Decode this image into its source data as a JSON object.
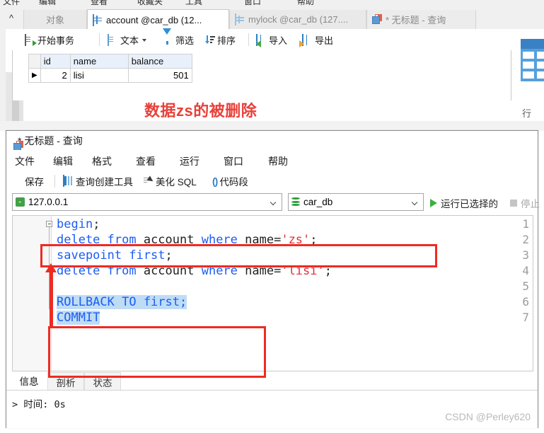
{
  "background_window": {
    "clipped_menu": [
      "文件",
      "编辑",
      "查看",
      "收藏夹",
      "工具",
      "窗口",
      "帮助"
    ],
    "collapse_icon": "^",
    "tabs": [
      {
        "label": "对象",
        "icon": "none",
        "state": "inactive"
      },
      {
        "label": "account @car_db (12...",
        "icon": "grid-icon",
        "state": "active"
      },
      {
        "label": "mylock @car_db (127....",
        "icon": "grid-icon",
        "state": "inactive"
      },
      {
        "label": "* 无标题 - 查询",
        "icon": "query-icon",
        "state": "inactive"
      }
    ],
    "toolbar": [
      {
        "label": "开始事务",
        "icon": "begin-transaction-icon"
      },
      {
        "label": "文本",
        "icon": "text-icon",
        "has_caret": true
      },
      {
        "label": "筛选",
        "icon": "filter-icon"
      },
      {
        "label": "排序",
        "icon": "sort-icon"
      },
      {
        "label": "导入",
        "icon": "import-icon"
      },
      {
        "label": "导出",
        "icon": "export-icon"
      }
    ],
    "result_grid": {
      "columns": [
        "id",
        "name",
        "balance"
      ],
      "rows": [
        {
          "marker": "▶",
          "id": "2",
          "name": "lisi",
          "balance": "501"
        }
      ]
    },
    "right_panel": {
      "icon": "table-grid-icon",
      "label": "行"
    },
    "annotation_text": "数据zs的被删除",
    "annotation_color": "#e8403a"
  },
  "query_window": {
    "title": "* 无标题 - 查询",
    "title_icon": "query-icon",
    "menu": [
      "文件",
      "编辑",
      "格式",
      "查看",
      "运行",
      "窗口",
      "帮助"
    ],
    "toolbar": [
      {
        "label": "保存",
        "icon": "save-icon"
      },
      {
        "label": "查询创建工具",
        "icon": "query-builder-icon"
      },
      {
        "label": "美化 SQL",
        "icon": "beautify-icon"
      },
      {
        "label": "代码段",
        "icon": "snippet-icon"
      }
    ],
    "connection": {
      "host_value": "127.0.0.1",
      "host_icon": "connection-icon",
      "database_value": "car_db",
      "database_icon": "database-icon",
      "run_label": "运行已选择的",
      "run_icon": "play-icon",
      "stop_label": "停止",
      "stop_icon": "stop-icon"
    },
    "editor": {
      "line_numbers": [
        "1",
        "2",
        "3",
        "4",
        "5",
        "6",
        "7"
      ],
      "lines": [
        {
          "n": "1",
          "tokens": [
            {
              "t": "begin",
              "c": "kw"
            },
            {
              "t": ";",
              "c": "pl"
            }
          ],
          "selected": false
        },
        {
          "n": "2",
          "tokens": [
            {
              "t": "delete from ",
              "c": "kw"
            },
            {
              "t": "account ",
              "c": "pl"
            },
            {
              "t": "where ",
              "c": "kw"
            },
            {
              "t": "name=",
              "c": "pl"
            },
            {
              "t": "'zs'",
              "c": "str"
            },
            {
              "t": ";",
              "c": "pl"
            }
          ],
          "selected": false
        },
        {
          "n": "3",
          "tokens": [
            {
              "t": "savepoint first",
              "c": "kw"
            },
            {
              "t": ";",
              "c": "pl"
            }
          ],
          "selected": false
        },
        {
          "n": "4",
          "tokens": [
            {
              "t": "delete from ",
              "c": "kw"
            },
            {
              "t": "account ",
              "c": "pl"
            },
            {
              "t": "where ",
              "c": "kw"
            },
            {
              "t": "name=",
              "c": "pl"
            },
            {
              "t": "'lisi'",
              "c": "str"
            },
            {
              "t": ";",
              "c": "pl"
            }
          ],
          "selected": false
        },
        {
          "n": "5",
          "tokens": [],
          "selected": false
        },
        {
          "n": "6",
          "tokens": [
            {
              "t": "ROLLBACK TO first;",
              "c": "kw"
            }
          ],
          "selected": true
        },
        {
          "n": "7",
          "tokens": [
            {
              "t": "COMMIT",
              "c": "kw"
            }
          ],
          "selected": true
        }
      ]
    },
    "bottom_tabs": [
      {
        "label": "信息",
        "state": "active"
      },
      {
        "label": "剖析",
        "state": "idle"
      },
      {
        "label": "状态",
        "state": "idle"
      }
    ],
    "message": "> 时间: 0s",
    "watermark": "CSDN @Perley620"
  },
  "annotations": {
    "box_line2": "highlight delete-zs statement",
    "box_rollback": "highlight rollback and commit",
    "arrow": "up-arrow"
  }
}
